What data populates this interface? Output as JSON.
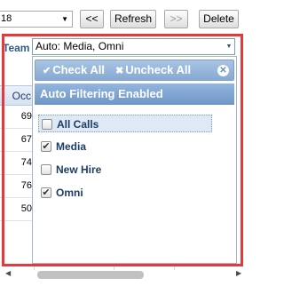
{
  "toolbar": {
    "select_value": "18",
    "prev_label": "<<",
    "refresh_label": "Refresh",
    "next_label": ">>",
    "delete_label": "Delete"
  },
  "filter": {
    "team_label": "Team",
    "team_value": "Auto: Media, Omni"
  },
  "grid": {
    "occ_header": "Occ",
    "occ_values": [
      "69",
      "67",
      "74",
      "76",
      "50"
    ]
  },
  "dropdown": {
    "check_all": "Check All",
    "uncheck_all": "Uncheck All",
    "header": "Auto Filtering Enabled",
    "items": [
      {
        "label": "All Calls",
        "checked": false
      },
      {
        "label": "Media",
        "checked": true
      },
      {
        "label": "New Hire",
        "checked": false
      },
      {
        "label": "Omni",
        "checked": true
      }
    ]
  },
  "icons": {
    "check_all_icon": "check-icon",
    "uncheck_all_icon": "x-icon",
    "close_icon": "close-icon"
  },
  "colors": {
    "highlight": "#e8393a",
    "panel_header": "#7a9fcf",
    "label_text": "#1c3d66"
  }
}
